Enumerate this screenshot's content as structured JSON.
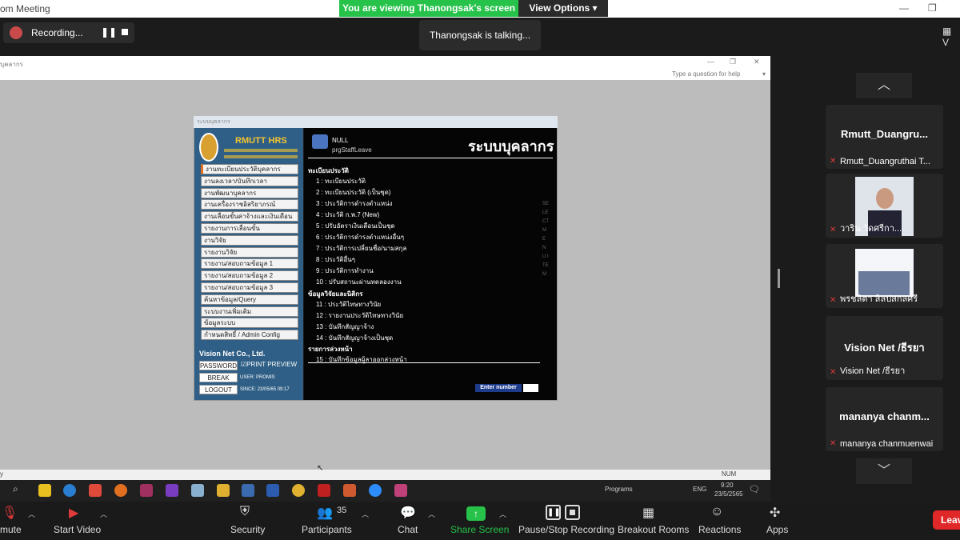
{
  "window": {
    "title": "om Meeting"
  },
  "banner": {
    "viewing_text": "You are viewing Thanongsak's screen",
    "view_options": "View Options"
  },
  "recording": {
    "label": "Recording..."
  },
  "talking": {
    "text": "Thanongsak is talking..."
  },
  "grid_icon": {
    "label": "V"
  },
  "shared_app": {
    "window_title": "บุคลากร",
    "help_placeholder": "Type a question for help",
    "dialog_title": "ระบบบุคลากร",
    "logo_title": "RMUTT HRS",
    "header_null": "NULL",
    "header_form": "prgStaffLeave",
    "header_big": "ระบบบุคลากร",
    "vertical_text": "SELECT MENU ITEM",
    "menu_items": [
      "งานทะเบียนประวัติบุคลากร",
      "งานลงเวลา/บันทึกเวลา",
      "งานพัฒนาบุคลากร",
      "งานเครื่องราชอิสริยาภรณ์",
      "งานเลื่อนขั้นค่าจ้างและเงินเดือน",
      "รายงานการเลื่อนขั้น",
      "งานวิจัย",
      "รายงานวิจัย",
      "รายงาน/สอบถามข้อมูล 1",
      "รายงาน/สอบถามข้อมูล 2",
      "รายงาน/สอบถามข้อมูล 3",
      "ค้นหาข้อมูล/Query",
      "ระบบงานเพิ่มเติม",
      "ข้อมูลระบบ",
      "กำหนดสิทธิ์ / Admin Config"
    ],
    "company": "Vision Net Co., Ltd.",
    "password_btn": "PASSWORD",
    "print_preview": "PRINT PREVIEW",
    "break_btn": "BREAK",
    "logout_btn": "LOGOUT",
    "user_label": "USER: PROMIS",
    "since_label": "SINCE: 23/05/65 09:17",
    "section1": "ทะเบียนประวัติ",
    "items1": [
      "1 : ทะเบียนประวัติ",
      "2 : ทะเบียนประวัติ (เป็นชุด)",
      "3 : ประวัติการดำรงตำแหน่ง",
      "4 : ประวัติ ก.พ.7 (New)",
      "5 : ปรับอัตราเงินเดือนเป็นชุด",
      "6 : ประวัติการดำรงตำแหน่งอื่นๆ",
      "7 : ประวัติการเปลี่ยนชื่อ/นามสกุล",
      "8 : ประวัติอื่นๆ",
      "9 : ประวัติการทำงาน",
      "10 : ปรับสถานะผ่านทดลองงาน"
    ],
    "section2": "ข้อมูลวิจัยและนิติกร",
    "items2": [
      "11 : ประวัติไทษทางวินัย",
      "12 : รายงานประวัติไทษทางวินัย",
      "13 : บันทึกสัญญาจ้าง",
      "14 : บันทึกสัญญาจ้างเป็นชุด"
    ],
    "section3": "รายการล่วงหน้า",
    "items3": [
      "15 : บันทึกข้อมูลผู้ลาออกล่วงหน้า"
    ],
    "enter_number": "Enter number",
    "status_num": "NUM",
    "status_left": "y"
  },
  "taskbar": {
    "programs": "Programs",
    "lang": "ENG",
    "time": "9:20",
    "date": "23/5/2565"
  },
  "participants": [
    {
      "name": "Rmutt_Duangru...",
      "label": "Rmutt_Duangruthai T..."
    },
    {
      "name": "",
      "label": "วาริน วัดศรีกา..."
    },
    {
      "name": "",
      "label": "พรชลิตา สิลปสกลศรี"
    },
    {
      "name": "Vision Net /ธีรยา",
      "label": "Vision Net /ธีรยา"
    },
    {
      "name": "mananya chanm...",
      "label": "mananya chanmuenwai"
    }
  ],
  "toolbar": {
    "mute": "mute",
    "start_video": "Start Video",
    "security": "Security",
    "participants": "Participants",
    "participants_count": "35",
    "chat": "Chat",
    "share_screen": "Share Screen",
    "pause_recording": "Pause/Stop Recording",
    "breakout": "Breakout Rooms",
    "reactions": "Reactions",
    "apps": "Apps",
    "leave": "Leav"
  },
  "colors": {
    "banner_green": "#26c24a",
    "leave_red": "#e02828",
    "menu_blue": "#2f5f86"
  }
}
